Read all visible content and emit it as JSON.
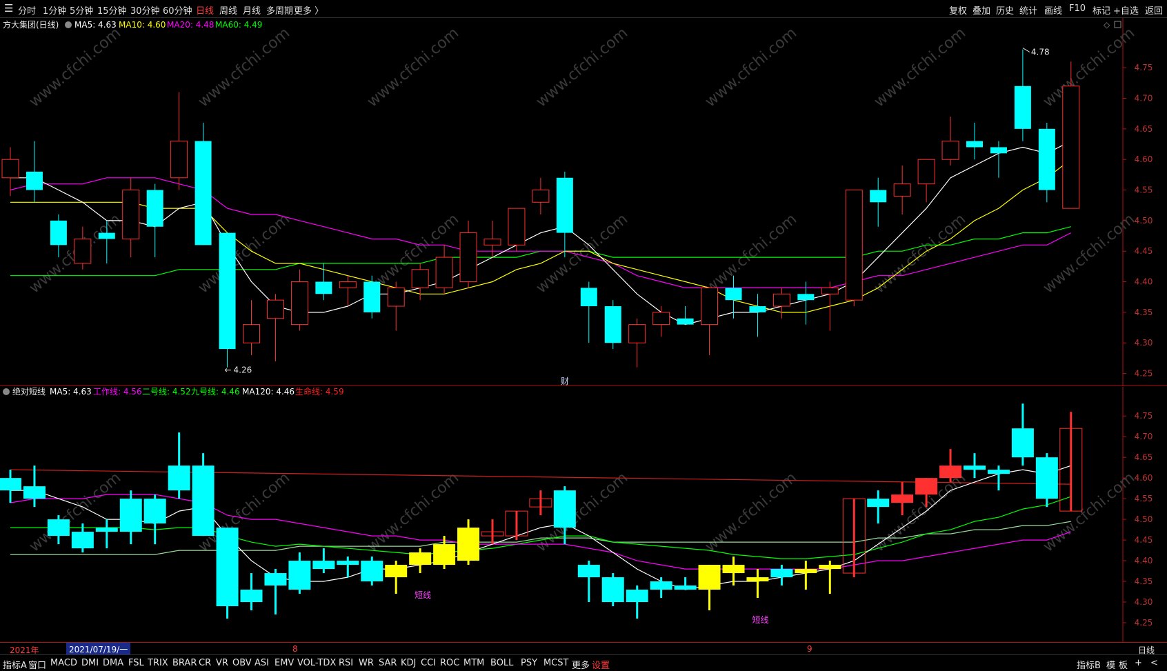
{
  "toolbar": {
    "left": [
      {
        "label": "分时"
      },
      {
        "label": "1分钟"
      },
      {
        "label": "5分钟"
      },
      {
        "label": "15分钟"
      },
      {
        "label": "30分钟"
      },
      {
        "label": "60分钟"
      },
      {
        "label": "日线",
        "active": true
      },
      {
        "label": "周线"
      },
      {
        "label": "月线"
      },
      {
        "label": "多周期"
      },
      {
        "label": "更多 〉"
      }
    ],
    "right": [
      {
        "label": "复权"
      },
      {
        "label": "叠加"
      },
      {
        "label": "历史"
      },
      {
        "label": "统计"
      },
      {
        "label": "画线"
      },
      {
        "label": "F10"
      },
      {
        "label": "标记"
      },
      {
        "label": "+自选"
      },
      {
        "label": "返回"
      }
    ]
  },
  "main_chart": {
    "title": "方大集团(日线)",
    "indicators": [
      {
        "label": "MA5: 4.63",
        "color": "#ffffff"
      },
      {
        "label": "MA10: 4.60",
        "color": "#ffff00"
      },
      {
        "label": "MA20: 4.48",
        "color": "#ff00ff"
      },
      {
        "label": "MA60: 4.49",
        "color": "#00ff00"
      }
    ],
    "price_ticks": [
      "4.75",
      "4.70",
      "4.65",
      "4.60",
      "4.55",
      "4.50",
      "4.45",
      "4.40",
      "4.35",
      "4.30",
      "4.25"
    ],
    "high_label": "4.78",
    "low_label": "4.26",
    "event_marker": "财"
  },
  "sub_chart": {
    "title": "绝对短线",
    "indicators": [
      {
        "label": "MA5: 4.63",
        "color": "#ffffff"
      },
      {
        "label": "工作线: 4.56",
        "color": "#ff00ff"
      },
      {
        "label": "二号线: 4.52",
        "color": "#00ff00"
      },
      {
        "label": "九号线: 4.46",
        "color": "#00ff00"
      },
      {
        "label": "MA120: 4.46",
        "color": "#ffffff"
      },
      {
        "label": "生命线: 4.59",
        "color": "#ff2020"
      }
    ],
    "price_ticks": [
      "4.75",
      "4.70",
      "4.65",
      "4.60",
      "4.55",
      "4.50",
      "4.45",
      "4.40",
      "4.35",
      "4.30",
      "4.25"
    ],
    "annotations": [
      "短线",
      "短线"
    ]
  },
  "datebar": {
    "year": "2021年",
    "cursor_date": "2021/07/19/一",
    "month_8": "8",
    "month_9": "9",
    "period": "日线"
  },
  "bottombar": {
    "left": [
      "指标A",
      "窗口",
      "MACD",
      "DMI",
      "DMA",
      "FSL",
      "TRIX",
      "BRAR",
      "CR",
      "VR",
      "OBV",
      "ASI",
      "EMV",
      "VOL-TDX",
      "RSI",
      "WR",
      "SAR",
      "KDJ",
      "CCI",
      "ROC",
      "MTM",
      "BOLL",
      "PSY",
      "MCST",
      "更多",
      "设置"
    ],
    "right": [
      "指标B",
      "模",
      "板",
      "+",
      "<"
    ]
  },
  "watermark": "www.cfchi.com",
  "colors": {
    "up": "#ff3030",
    "down": "#00ffff",
    "ma5": "#ffffff",
    "ma10": "#ffff00",
    "ma20": "#ff00ff",
    "ma60": "#00ff00"
  },
  "chart_data": {
    "type": "candlestick",
    "symbol": "方大集团",
    "period": "日线",
    "ylim": [
      4.23,
      4.79
    ],
    "candles": [
      {
        "o": 4.57,
        "c": 4.6,
        "h": 4.62,
        "l": 4.54
      },
      {
        "o": 4.58,
        "c": 4.55,
        "h": 4.63,
        "l": 4.53
      },
      {
        "o": 4.5,
        "c": 4.46,
        "h": 4.51,
        "l": 4.44
      },
      {
        "o": 4.43,
        "c": 4.47,
        "h": 4.49,
        "l": 4.42
      },
      {
        "o": 4.48,
        "c": 4.47,
        "h": 4.5,
        "l": 4.43
      },
      {
        "o": 4.47,
        "c": 4.55,
        "h": 4.57,
        "l": 4.44
      },
      {
        "o": 4.55,
        "c": 4.49,
        "h": 4.56,
        "l": 4.44
      },
      {
        "o": 4.57,
        "c": 4.63,
        "h": 4.71,
        "l": 4.55
      },
      {
        "o": 4.63,
        "c": 4.46,
        "h": 4.66,
        "l": 4.46
      },
      {
        "o": 4.48,
        "c": 4.29,
        "h": 4.48,
        "l": 4.26
      },
      {
        "o": 4.3,
        "c": 4.33,
        "h": 4.37,
        "l": 4.28
      },
      {
        "o": 4.34,
        "c": 4.37,
        "h": 4.38,
        "l": 4.27
      },
      {
        "o": 4.33,
        "c": 4.4,
        "h": 4.42,
        "l": 4.32
      },
      {
        "o": 4.4,
        "c": 4.38,
        "h": 4.43,
        "l": 4.37
      },
      {
        "o": 4.39,
        "c": 4.4,
        "h": 4.41,
        "l": 4.36
      },
      {
        "o": 4.4,
        "c": 4.35,
        "h": 4.41,
        "l": 4.34
      },
      {
        "o": 4.36,
        "c": 4.39,
        "h": 4.4,
        "l": 4.32
      },
      {
        "o": 4.39,
        "c": 4.42,
        "h": 4.43,
        "l": 4.37
      },
      {
        "o": 4.39,
        "c": 4.44,
        "h": 4.46,
        "l": 4.38
      },
      {
        "o": 4.4,
        "c": 4.48,
        "h": 4.5,
        "l": 4.39
      },
      {
        "o": 4.46,
        "c": 4.47,
        "h": 4.5,
        "l": 4.44
      },
      {
        "o": 4.46,
        "c": 4.52,
        "h": 4.52,
        "l": 4.45
      },
      {
        "o": 4.53,
        "c": 4.55,
        "h": 4.57,
        "l": 4.51
      },
      {
        "o": 4.57,
        "c": 4.48,
        "h": 4.58,
        "l": 4.44
      },
      {
        "o": 4.39,
        "c": 4.36,
        "h": 4.4,
        "l": 4.3
      },
      {
        "o": 4.36,
        "c": 4.3,
        "h": 4.37,
        "l": 4.29
      },
      {
        "o": 4.3,
        "c": 4.33,
        "h": 4.34,
        "l": 4.26
      },
      {
        "o": 4.33,
        "c": 4.35,
        "h": 4.36,
        "l": 4.31
      },
      {
        "o": 4.34,
        "c": 4.33,
        "h": 4.36,
        "l": 4.33
      },
      {
        "o": 4.33,
        "c": 4.39,
        "h": 4.39,
        "l": 4.28
      },
      {
        "o": 4.39,
        "c": 4.37,
        "h": 4.41,
        "l": 4.34
      },
      {
        "o": 4.36,
        "c": 4.35,
        "h": 4.38,
        "l": 4.31
      },
      {
        "o": 4.36,
        "c": 4.38,
        "h": 4.39,
        "l": 4.34
      },
      {
        "o": 4.38,
        "c": 4.37,
        "h": 4.4,
        "l": 4.33
      },
      {
        "o": 4.38,
        "c": 4.39,
        "h": 4.4,
        "l": 4.32
      },
      {
        "o": 4.37,
        "c": 4.55,
        "h": 4.55,
        "l": 4.36
      },
      {
        "o": 4.55,
        "c": 4.53,
        "h": 4.57,
        "l": 4.49
      },
      {
        "o": 4.54,
        "c": 4.56,
        "h": 4.59,
        "l": 4.51
      },
      {
        "o": 4.56,
        "c": 4.6,
        "h": 4.6,
        "l": 4.53
      },
      {
        "o": 4.6,
        "c": 4.63,
        "h": 4.67,
        "l": 4.59
      },
      {
        "o": 4.63,
        "c": 4.62,
        "h": 4.66,
        "l": 4.6
      },
      {
        "o": 4.62,
        "c": 4.61,
        "h": 4.63,
        "l": 4.57
      },
      {
        "o": 4.72,
        "c": 4.65,
        "h": 4.78,
        "l": 4.63
      },
      {
        "o": 4.65,
        "c": 4.55,
        "h": 4.66,
        "l": 4.53
      },
      {
        "o": 4.52,
        "c": 4.72,
        "h": 4.76,
        "l": 4.52
      }
    ],
    "ma5": [
      4.57,
      4.57,
      4.55,
      4.53,
      4.5,
      4.5,
      4.49,
      4.52,
      4.53,
      4.46,
      4.4,
      4.36,
      4.35,
      4.35,
      4.36,
      4.38,
      4.38,
      4.39,
      4.4,
      4.42,
      4.44,
      4.46,
      4.48,
      4.49,
      4.46,
      4.42,
      4.38,
      4.35,
      4.33,
      4.34,
      4.35,
      4.35,
      4.36,
      4.37,
      4.38,
      4.4,
      4.44,
      4.48,
      4.52,
      4.57,
      4.59,
      4.61,
      4.62,
      4.61,
      4.63
    ],
    "ma10": [
      4.53,
      4.53,
      4.53,
      4.53,
      4.53,
      4.53,
      4.52,
      4.52,
      4.52,
      4.48,
      4.45,
      4.43,
      4.43,
      4.42,
      4.41,
      4.4,
      4.39,
      4.38,
      4.38,
      4.39,
      4.4,
      4.42,
      4.43,
      4.45,
      4.45,
      4.43,
      4.42,
      4.41,
      4.4,
      4.39,
      4.37,
      4.36,
      4.35,
      4.35,
      4.36,
      4.37,
      4.39,
      4.42,
      4.45,
      4.47,
      4.5,
      4.52,
      4.55,
      4.57,
      4.6
    ],
    "ma20": [
      4.55,
      4.56,
      4.56,
      4.56,
      4.57,
      4.57,
      4.57,
      4.56,
      4.55,
      4.52,
      4.51,
      4.51,
      4.5,
      4.49,
      4.48,
      4.47,
      4.47,
      4.46,
      4.46,
      4.45,
      4.45,
      4.45,
      4.45,
      4.45,
      4.44,
      4.43,
      4.41,
      4.4,
      4.39,
      4.39,
      4.39,
      4.39,
      4.39,
      4.39,
      4.39,
      4.4,
      4.41,
      4.41,
      4.42,
      4.43,
      4.44,
      4.45,
      4.46,
      4.46,
      4.48
    ],
    "ma60": [
      4.41,
      4.41,
      4.41,
      4.41,
      4.41,
      4.41,
      4.41,
      4.42,
      4.42,
      4.42,
      4.42,
      4.42,
      4.43,
      4.43,
      4.43,
      4.43,
      4.43,
      4.43,
      4.44,
      4.44,
      4.44,
      4.44,
      4.45,
      4.45,
      4.45,
      4.44,
      4.44,
      4.44,
      4.44,
      4.44,
      4.44,
      4.44,
      4.44,
      4.44,
      4.44,
      4.44,
      4.45,
      4.45,
      4.46,
      4.46,
      4.47,
      4.47,
      4.48,
      4.48,
      4.49
    ]
  }
}
